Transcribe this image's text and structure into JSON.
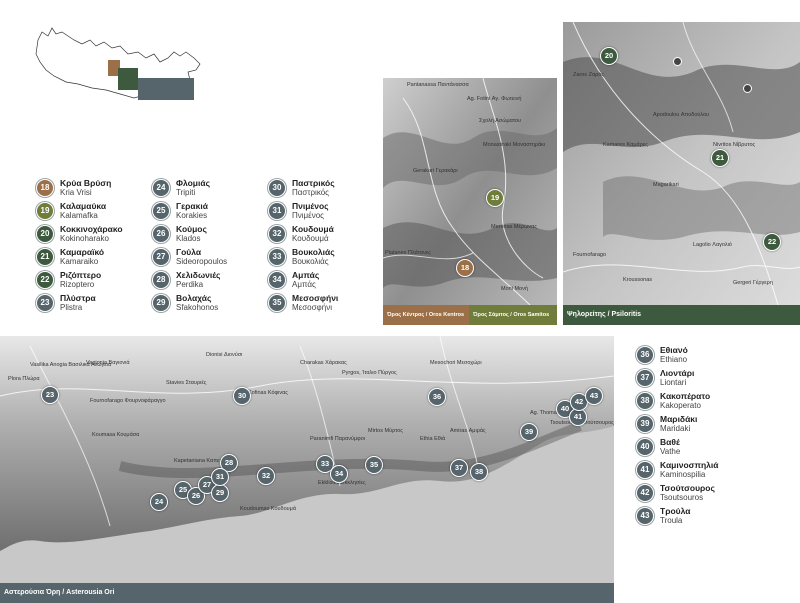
{
  "colors": {
    "brown": "#9b7048",
    "olive": "#6f7c3a",
    "green": "#3d5a3e",
    "slate": "#56646b",
    "sea": "#c8c8c8"
  },
  "legend_left": [
    {
      "num": "18",
      "title": "Κρύα Βρύση",
      "sub": "Kria Vrisi",
      "color": "brown"
    },
    {
      "num": "19",
      "title": "Καλαμαύκα",
      "sub": "Kalamafka",
      "color": "olive"
    },
    {
      "num": "20",
      "title": "Κοκκινοχάρακο",
      "sub": "Kokinoharako",
      "color": "green"
    },
    {
      "num": "21",
      "title": "Καμαραϊκό",
      "sub": "Kamaraiko",
      "color": "green"
    },
    {
      "num": "22",
      "title": "Ριζόπτερο",
      "sub": "Rizoptero",
      "color": "green"
    },
    {
      "num": "23",
      "title": "Πλύστρα",
      "sub": "Plistra",
      "color": "slate"
    }
  ],
  "legend_mid": [
    {
      "num": "24",
      "title": "Φλομιάς",
      "sub": "Tripiti"
    },
    {
      "num": "25",
      "title": "Γερακιά",
      "sub": "Korakies"
    },
    {
      "num": "26",
      "title": "Κούμος",
      "sub": "Klados"
    },
    {
      "num": "27",
      "title": "Γούλα",
      "sub": "Sideoropoulos"
    },
    {
      "num": "28",
      "title": "Χελιδωνιές",
      "sub": "Perdika"
    },
    {
      "num": "29",
      "title": "Βολαχάς",
      "sub": "Sfakohonos"
    }
  ],
  "legend_right": [
    {
      "num": "30",
      "title": "Παστρικός",
      "sub": "Παστρικός"
    },
    {
      "num": "31",
      "title": "Πνιμένος",
      "sub": "Πνιμένος"
    },
    {
      "num": "32",
      "title": "Κουδουμά",
      "sub": "Κουδουμά"
    },
    {
      "num": "33",
      "title": "Βουκολιάς",
      "sub": "Βουκολιάς"
    },
    {
      "num": "34",
      "title": "Αμπάς",
      "sub": "Αμπάς"
    },
    {
      "num": "35",
      "title": "Μεσοσφήνι",
      "sub": "Μεσοσφήνι"
    }
  ],
  "legend_bottom": [
    {
      "num": "36",
      "title": "Εθιανό",
      "sub": "Ethiano"
    },
    {
      "num": "37",
      "title": "Λιοντάρι",
      "sub": "Liontari"
    },
    {
      "num": "38",
      "title": "Κακοπέρατο",
      "sub": "Kakoperato"
    },
    {
      "num": "39",
      "title": "Μαριδάκι",
      "sub": "Maridaki"
    },
    {
      "num": "40",
      "title": "Βαθέ",
      "sub": "Vathe"
    },
    {
      "num": "41",
      "title": "Καμινοσπηλιά",
      "sub": "Kaminospilia"
    },
    {
      "num": "42",
      "title": "Τσούτσουρος",
      "sub": "Tsoutsouros"
    },
    {
      "num": "43",
      "title": "Τρούλα",
      "sub": "Troula"
    }
  ],
  "maps": {
    "kentros": {
      "caption": "Όρος Κέντρος / Oros Kentros",
      "caption2": "Όρος Σάμιτος / Oros Samitos",
      "markers": [
        "19",
        "18"
      ],
      "labels": [
        "Pantanassa Παντάνασσα",
        "Ag. Fotini Αγ. Φωτεινή",
        "Σχολή Ασώματου",
        "Monastiraki Μοναστηράκι",
        "Gerakari Γερακάρι",
        "Meronas Μέρωνας",
        "Platanes Πλάτανες",
        "Moni Μονή"
      ]
    },
    "psiloritis": {
      "caption": "Ψηλορείτης / Psiloritis",
      "markers": [
        "20",
        "21",
        "22"
      ],
      "labels": [
        "Zaros Ζαρός",
        "Kamares Καμάρες",
        "Nivritos Νίβρυτος",
        "Magarikari",
        "Lagolio Λαγολιό",
        "Kroussonas",
        "Gergeri Γέργερη",
        "Apodoulou Αποδούλου",
        "Fournofarago"
      ]
    },
    "asterousia": {
      "caption": "Αστερούσια Όρη / Asterousia Ori",
      "markers": [
        "23",
        "24",
        "25",
        "26",
        "27",
        "28",
        "29",
        "30",
        "31",
        "32",
        "33",
        "34",
        "35",
        "36",
        "37",
        "38",
        "39",
        "40",
        "41",
        "42",
        "43"
      ],
      "labels": [
        "Vasilika Anogia Βασιλικά Ανώγεια",
        "Vagionia Βαγιονιά",
        "Charakas Χάρακας",
        "Pyrgos, Ίταλιο Πύργος",
        "Mesochori Μεσοχώρι",
        "Dionisi Διονύσι",
        "Stavies Σταυριές",
        "Fournofarago Φουρνοφάραγγο",
        "Koumasa Κουμάσα",
        "Paranimfi Παρανύμφοι",
        "Ethia Εθιά",
        "Amiras Αμιράς",
        "Kofinas Κόφινας",
        "Ag. Thomas",
        "Koudoumas Κουδουμά",
        "Plora Πλώρα",
        "Mirtos Μύρτος",
        "Kapetaniana Καπετανιανά",
        "Ekklisies Εκκλησίες",
        "Tsoutsouros Τσούτσουρος"
      ]
    }
  }
}
